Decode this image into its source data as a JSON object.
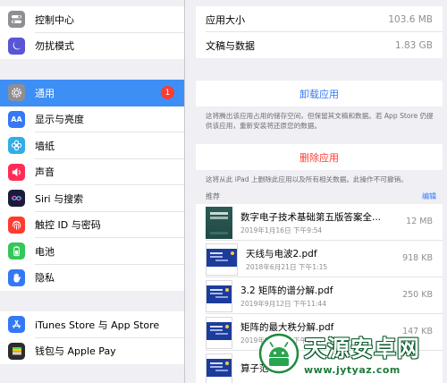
{
  "sidebar": {
    "group1": [
      {
        "label": "控制中心",
        "icon": "control-center-icon",
        "color": "#8e8e93"
      },
      {
        "label": "勿扰模式",
        "icon": "moon-icon",
        "color": "#5856d6"
      }
    ],
    "group2": [
      {
        "label": "通用",
        "icon": "gear-icon",
        "color": "#8e8e93",
        "badge": "1",
        "selected": true
      },
      {
        "label": "显示与亮度",
        "icon": "display-text-size-icon",
        "color": "#3478f6"
      },
      {
        "label": "墙纸",
        "icon": "wallpaper-flower-icon",
        "color": "#32ade6"
      },
      {
        "label": "声音",
        "icon": "speaker-icon",
        "color": "#ff2d55"
      },
      {
        "label": "Siri 与搜索",
        "icon": "siri-icon",
        "color": "#1c1c3a"
      },
      {
        "label": "触控 ID 与密码",
        "icon": "fingerprint-icon",
        "color": "#ff3b30"
      },
      {
        "label": "电池",
        "icon": "battery-icon",
        "color": "#34c759"
      },
      {
        "label": "隐私",
        "icon": "hand-icon",
        "color": "#3478f6"
      }
    ],
    "group3": [
      {
        "label": "iTunes Store 与 App Store",
        "icon": "app-store-icon",
        "color": "#3478f6"
      },
      {
        "label": "钱包与 Apple Pay",
        "icon": "wallet-icon",
        "color": "#2c2c2e"
      }
    ]
  },
  "main": {
    "info": [
      {
        "label": "应用大小",
        "value": "103.6 MB"
      },
      {
        "label": "文稿与数据",
        "value": "1.83 GB"
      }
    ],
    "offload": {
      "label": "卸载应用",
      "color": "#3478f6",
      "note": "这将腾出该应用占用的储存空间，但保留其文稿和数据。若 App Store 仍提供该应用，重新安装将还原您的数据。"
    },
    "delete": {
      "label": "删除应用",
      "color": "#ff3b30",
      "note": "这将从此 iPad 上删除此应用以及所有相关数据。此操作不可撤销。"
    },
    "recommended": {
      "label": "推荐",
      "edit": "编辑"
    },
    "files": [
      {
        "name": "数字电子技术基础第五版答案全...",
        "date": "2019年1月16日 下午9:54",
        "size": "12 MB",
        "thumb": "book"
      },
      {
        "name": "天线与电波2.pdf",
        "date": "2018年6月21日 下午1:15",
        "size": "918 KB",
        "thumb": "doc-wide"
      },
      {
        "name": "3.2 矩阵的谱分解.pdf",
        "date": "2019年9月12日 下午11:44",
        "size": "250 KB",
        "thumb": "doc"
      },
      {
        "name": "矩阵的最大秩分解.pdf",
        "date": "2019年9月12日 下午11:4",
        "size": "147 KB",
        "thumb": "doc"
      },
      {
        "name": "算子范",
        "date": "",
        "size": "",
        "thumb": "doc"
      }
    ]
  },
  "watermark": {
    "title": "天源安卓网",
    "url": "www.jytyaz.com"
  }
}
